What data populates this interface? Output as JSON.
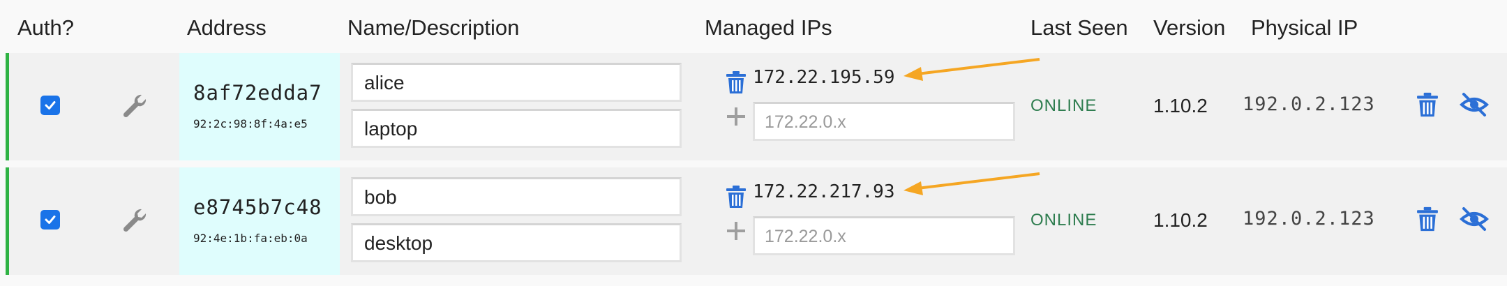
{
  "headers": {
    "auth": "Auth?",
    "address": "Address",
    "name": "Name/Description",
    "managed_ips": "Managed IPs",
    "last_seen": "Last Seen",
    "version": "Version",
    "physical_ip": "Physical IP"
  },
  "members": [
    {
      "authorized": true,
      "address": "8af72edda7",
      "mac": "92:2c:98:8f:4a:e5",
      "name": "alice",
      "description": "laptop",
      "managed_ip": "172.22.195.59",
      "ip_placeholder": "172.22.0.x",
      "status": "ONLINE",
      "version": "1.10.2",
      "physical_ip": "192.0.2.123"
    },
    {
      "authorized": true,
      "address": "e8745b7c48",
      "mac": "92:4e:1b:fa:eb:0a",
      "name": "bob",
      "description": "desktop",
      "managed_ip": "172.22.217.93",
      "ip_placeholder": "172.22.0.x",
      "status": "ONLINE",
      "version": "1.10.2",
      "physical_ip": "192.0.2.123"
    }
  ],
  "icons": {
    "settings": "wrench-icon",
    "delete_ip": "trash-icon",
    "add_ip": "plus-icon",
    "delete_member": "trash-icon",
    "hide_member": "eye-slash-icon",
    "annotation": "arrow-icon"
  },
  "colors": {
    "accent": "#1a73e8",
    "online": "#2e7d4f",
    "address_bg": "#dffdfd",
    "row_border": "#2fb344",
    "arrow": "#f5a623"
  }
}
